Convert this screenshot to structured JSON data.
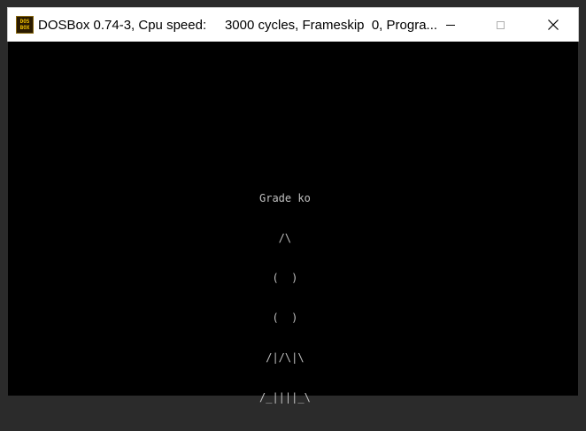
{
  "window": {
    "title": "DOSBox 0.74-3, Cpu speed:     3000 cycles, Frameskip  0, Progra...",
    "icon": {
      "name": "dosbox-icon",
      "line1": "DOS",
      "line2": "BOX"
    },
    "controls": {
      "minimize": "minimize-icon",
      "maximize": "maximize-icon",
      "close": "✕"
    }
  },
  "screen": {
    "background": "#000000",
    "text_color": "#c0c0c0",
    "lines": [
      "Grade ko",
      "   /\\",
      "  (  )",
      "  (  )",
      " /|/\\|\\",
      "/_||||_\\"
    ]
  }
}
